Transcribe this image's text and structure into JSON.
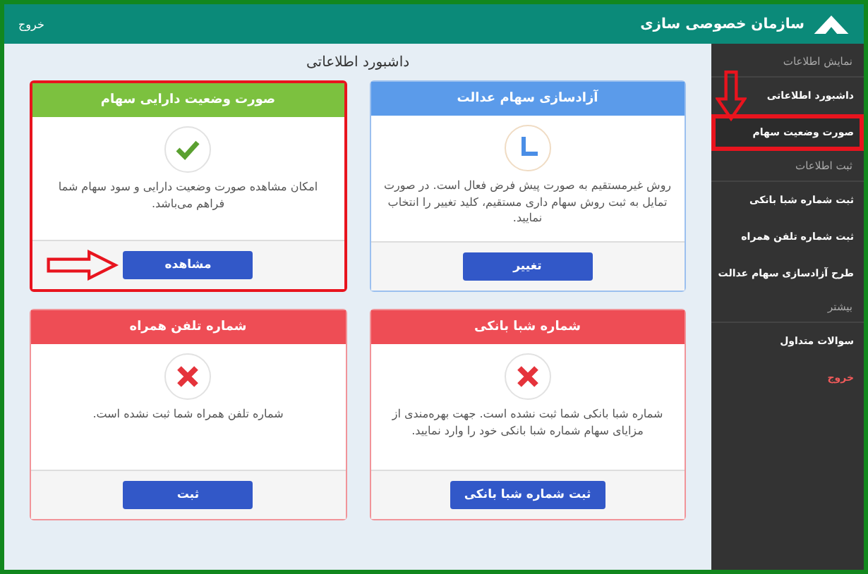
{
  "header": {
    "title": "سازمان خصوصی سازی",
    "logout": "خروج"
  },
  "sidebar": {
    "items": [
      {
        "kind": "heading",
        "label": "نمایش اطلاعات",
        "highlighted": false
      },
      {
        "kind": "link",
        "label": "داشبورد اطلاعاتی",
        "highlighted": false
      },
      {
        "kind": "link",
        "label": "صورت وضعیت سهام",
        "highlighted": true
      },
      {
        "kind": "heading",
        "label": "ثبت اطلاعات",
        "highlighted": false
      },
      {
        "kind": "link",
        "label": "ثبت شماره شبا بانکی",
        "highlighted": false
      },
      {
        "kind": "link",
        "label": "ثبت شماره تلفن همراه",
        "highlighted": false
      },
      {
        "kind": "link",
        "label": "طرح آزادسازی سهام عدالت",
        "highlighted": false
      },
      {
        "kind": "heading",
        "label": "بیشتر",
        "highlighted": false
      },
      {
        "kind": "link",
        "label": "سوالات متداول",
        "highlighted": false
      },
      {
        "kind": "danger",
        "label": "خروج",
        "highlighted": false
      }
    ]
  },
  "main": {
    "title": "داشبورد اطلاعاتی",
    "cards": [
      {
        "kind": "info",
        "title": "آزادسازی سهام عدالت",
        "text": "روش غیرمستقیم به صورت پیش فرض فعال است. در صورت تمایل به ثبت روش سهام داری مستقیم، کلید تغییر را انتخاب نمایید.",
        "button": "تغییر",
        "highlighted": false
      },
      {
        "kind": "success",
        "title": "صورت وضعیت دارایی سهام",
        "text": "امکان مشاهده صورت وضعیت دارایی و سود سهام شما فراهم می‌باشد.",
        "button": "مشاهده",
        "highlighted": true
      },
      {
        "kind": "danger",
        "title": "شماره شبا بانکی",
        "text": "شماره شبا بانکی شما ثبت نشده است. جهت بهره‌مندی از مزایای سهام شماره شبا بانکی خود را وارد نمایید.",
        "button": "ثبت شماره شبا بانکی",
        "highlighted": false
      },
      {
        "kind": "danger",
        "title": "شماره تلفن همراه",
        "text": "شماره تلفن همراه شما ثبت نشده است.",
        "button": "ثبت",
        "highlighted": false
      }
    ]
  }
}
